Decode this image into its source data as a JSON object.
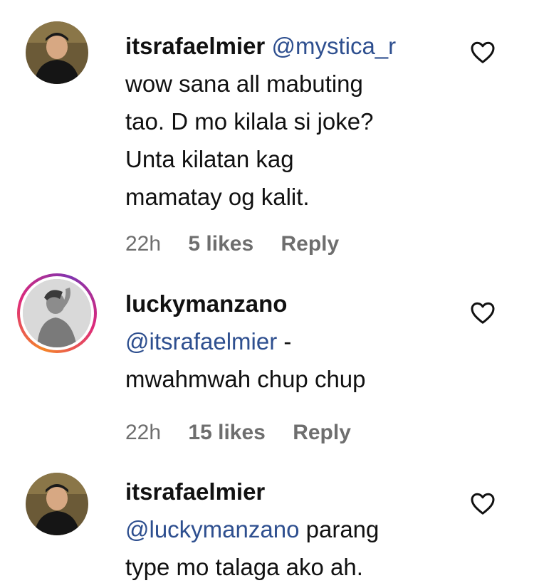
{
  "comments": [
    {
      "username": "itsrafaelmier",
      "mention": "@mystica_r",
      "text_lines": [
        "wow sana all mabuting",
        "tao. D mo kilala si joke?",
        "Unta kilatan kag",
        "mamatay og kalit."
      ],
      "time": "22h",
      "likes": "5 likes",
      "reply_label": "Reply",
      "avatar_story_ring": false
    },
    {
      "username": "luckymanzano",
      "mention": "@itsrafaelmier",
      "mention_suffix": " -",
      "text_lines": [
        "mwahmwah chup chup"
      ],
      "time": "22h",
      "likes": "15 likes",
      "reply_label": "Reply",
      "avatar_story_ring": true
    },
    {
      "username": "itsrafaelmier",
      "mention": "@luckymanzano",
      "mention_suffix": " parang",
      "text_lines": [
        "type mo talaga ako ah."
      ],
      "avatar_story_ring": false
    }
  ],
  "icons": {
    "like": "heart-outline-icon"
  },
  "colors": {
    "mention": "#2e4f8f",
    "meta": "#6e6e6e",
    "story_ring_start": "#f58529",
    "story_ring_end": "#dd2a7b"
  }
}
